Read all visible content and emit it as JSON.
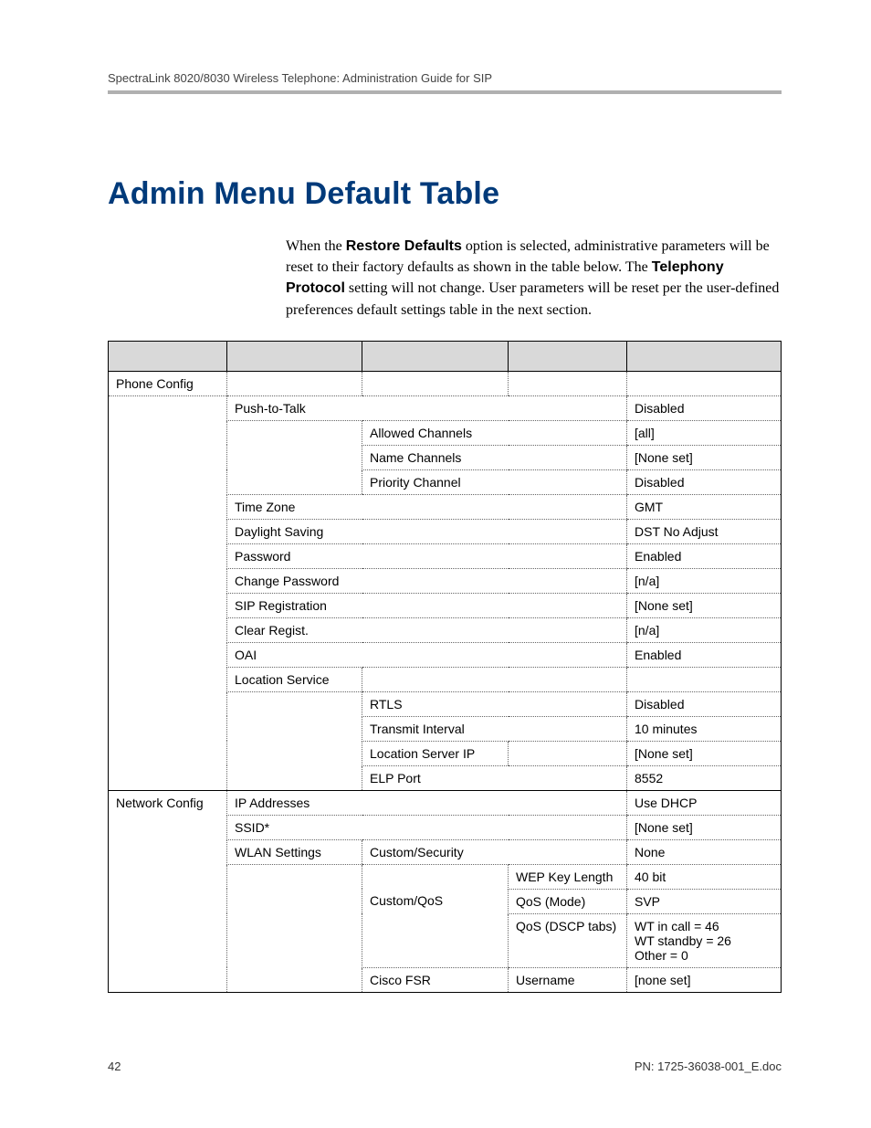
{
  "running_head": "SpectraLink 8020/8030 Wireless Telephone: Administration Guide for SIP",
  "title": "Admin Menu Default Table",
  "intro": {
    "part1": "When the ",
    "bold1": "Restore Defaults",
    "part2": " option is selected, administrative parameters will be reset to their factory defaults as shown in the table below.  The ",
    "bold2": "Telephony Protocol",
    "part3": " setting will not change. User parameters will be reset per the user-defined preferences default settings table in the next section."
  },
  "rows": {
    "phone_config": "Phone Config",
    "push_to_talk": "Push-to-Talk",
    "push_to_talk_val": "Disabled",
    "allowed_channels": "Allowed Channels",
    "allowed_channels_val": "[all]",
    "name_channels": "Name Channels",
    "name_channels_val": "[None set]",
    "priority_channel": "Priority Channel",
    "priority_channel_val": "Disabled",
    "time_zone": "Time Zone",
    "time_zone_val": "GMT",
    "daylight_saving": "Daylight Saving",
    "daylight_saving_val": "DST No Adjust",
    "password": "Password",
    "password_val": "Enabled",
    "change_password": "Change Password",
    "change_password_val": "[n/a]",
    "sip_registration": "SIP Registration",
    "sip_registration_val": "[None set]",
    "clear_regist": "Clear Regist.",
    "clear_regist_val": "[n/a]",
    "oai": "OAI",
    "oai_val": "Enabled",
    "location_service": "Location Service",
    "rtls": "RTLS",
    "rtls_val": "Disabled",
    "transmit_interval": "Transmit Interval",
    "transmit_interval_val": "10 minutes",
    "location_server_ip": "Location Server IP",
    "location_server_ip_val": "[None set]",
    "elp_port": "ELP Port",
    "elp_port_val": "8552",
    "network_config": "Network Config",
    "ip_addresses": "IP Addresses",
    "ip_addresses_val": "Use DHCP",
    "ssid": "SSID*",
    "ssid_val": "[None set]",
    "wlan_settings": "WLAN Settings",
    "custom_security": "Custom/Security",
    "custom_security_val": "None",
    "wep_key_length": "WEP Key Length",
    "wep_key_length_val": "40 bit",
    "custom_qos": "Custom/QoS",
    "qos_mode": "QoS (Mode)",
    "qos_mode_val": "SVP",
    "qos_dscp": "QoS (DSCP tabs)",
    "qos_dscp_val": "WT in call = 46\nWT standby = 26\nOther = 0",
    "cisco_fsr": "Cisco FSR",
    "username": "Username",
    "username_val": "[none set]"
  },
  "footer": {
    "page": "42",
    "pn": "PN: 1725-36038-001_E.doc"
  }
}
